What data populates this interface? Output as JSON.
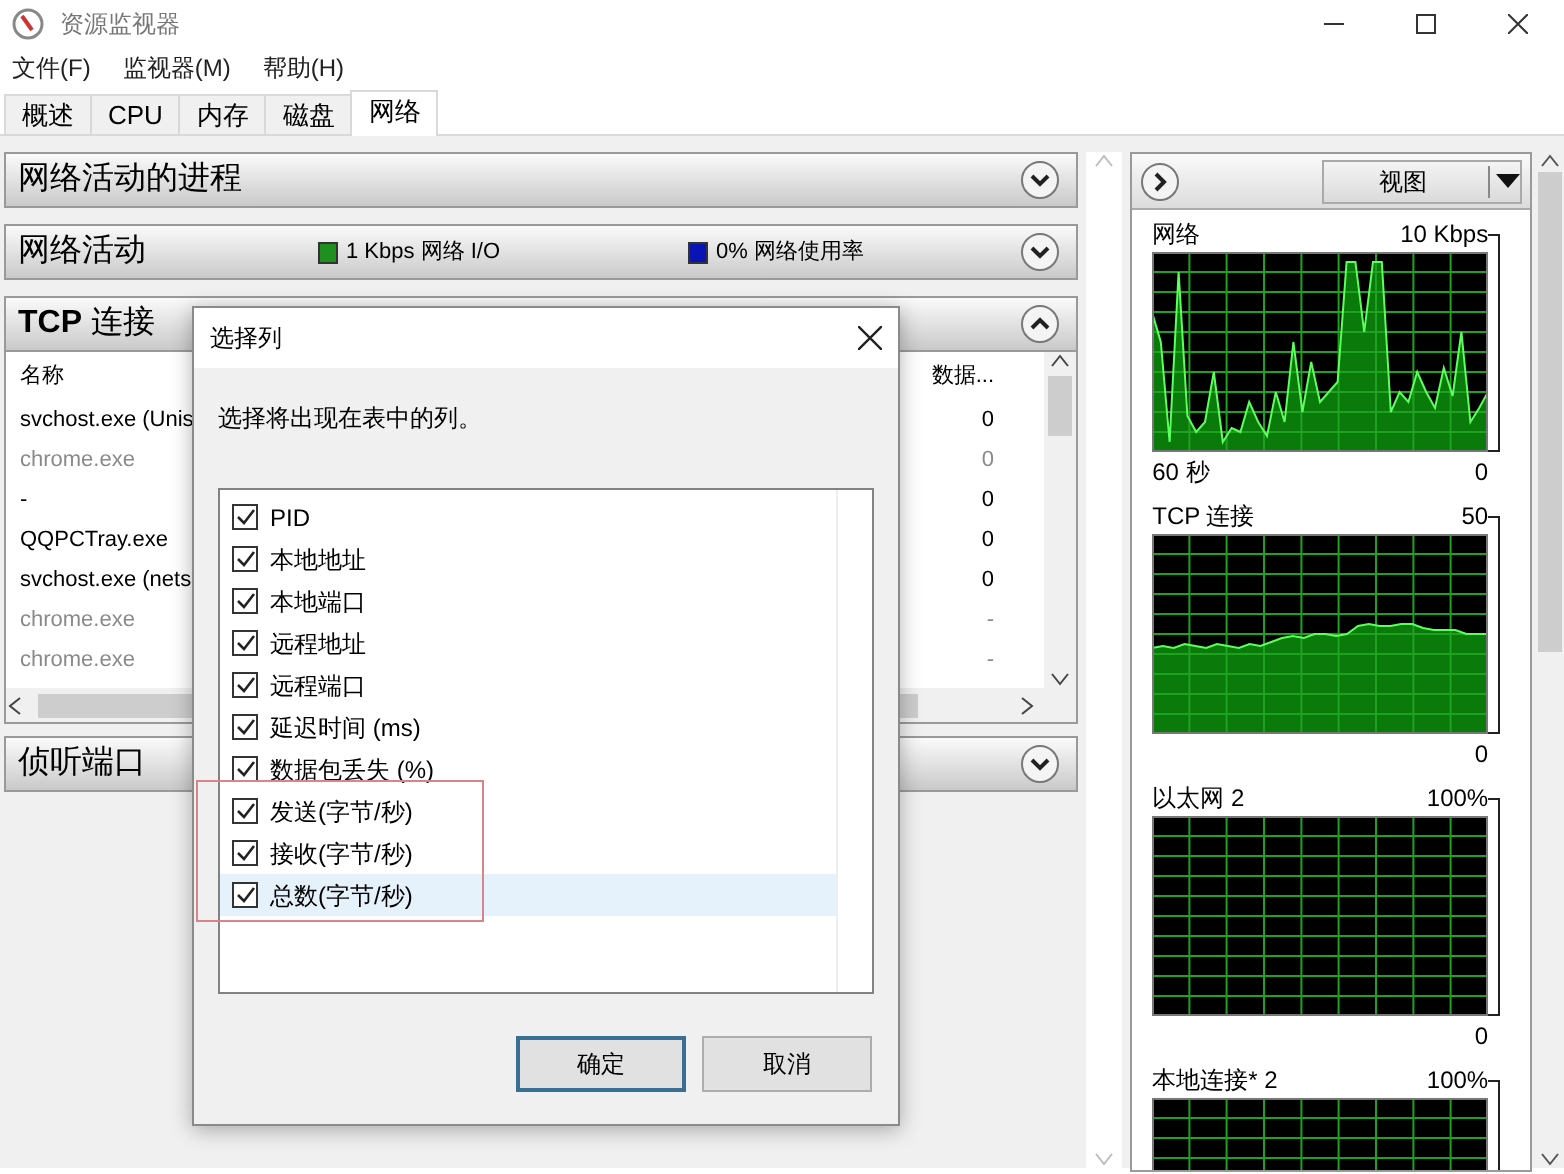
{
  "window": {
    "title": "资源监视器"
  },
  "menu": [
    {
      "label": "文件(F)"
    },
    {
      "label": "监视器(M)"
    },
    {
      "label": "帮助(H)"
    }
  ],
  "tabs": [
    {
      "label": "概述",
      "selected": false
    },
    {
      "label": "CPU",
      "selected": false
    },
    {
      "label": "内存",
      "selected": false
    },
    {
      "label": "磁盘",
      "selected": false
    },
    {
      "label": "网络",
      "selected": true
    }
  ],
  "sections": [
    {
      "kind": "plain",
      "title": "网络活动的进程",
      "expanded": false
    },
    {
      "kind": "activity",
      "title": "网络活动",
      "expanded": false,
      "legend": [
        {
          "text": "1 Kbps 网络 I/O",
          "color": "#1f8f1f"
        },
        {
          "text": "0% 网络使用率",
          "color": "#0a14b4"
        }
      ]
    },
    {
      "kind": "table",
      "title": "**TCP** 连接",
      "expanded": true,
      "table": {
        "columns": [
          "名称",
          "数据..."
        ],
        "rows": [
          [
            "svchost.exe (Unis",
            "0"
          ],
          [
            "chrome.exe",
            "0"
          ],
          [
            "-",
            "0"
          ],
          [
            "QQPCTray.exe",
            "0"
          ],
          [
            "svchost.exe (nets",
            "0"
          ],
          [
            "chrome.exe",
            "-"
          ],
          [
            "chrome.exe",
            "-"
          ]
        ],
        "dimmed": [
          false,
          true,
          false,
          false,
          false,
          true,
          true
        ]
      }
    },
    {
      "kind": "plain",
      "title": "侦听端口",
      "expanded": false
    }
  ],
  "graphs_panel": {
    "view_button": "视图",
    "graphs": [
      {
        "title": "网络",
        "max": "10 Kbps",
        "time": "60 秒",
        "min": "0"
      },
      {
        "title": "TCP 连接",
        "max": "50",
        "min": "0"
      },
      {
        "title": "以太网 2",
        "max": "100%",
        "min": "0"
      },
      {
        "title": "本地连接* 2",
        "max": "100%"
      }
    ]
  },
  "dialog": {
    "title": "选择列",
    "prompt": "选择将出现在表中的列。",
    "items": [
      {
        "label": "PID",
        "checked": true,
        "selected": false,
        "highlighted": false
      },
      {
        "label": "本地地址",
        "checked": true,
        "selected": false,
        "highlighted": false
      },
      {
        "label": "本地端口",
        "checked": true,
        "selected": false,
        "highlighted": false
      },
      {
        "label": "远程地址",
        "checked": true,
        "selected": false,
        "highlighted": false
      },
      {
        "label": "远程端口",
        "checked": true,
        "selected": false,
        "highlighted": false
      },
      {
        "label": "延迟时间 (ms)",
        "checked": true,
        "selected": false,
        "highlighted": false
      },
      {
        "label": "数据包丢失 (%)",
        "checked": true,
        "selected": false,
        "highlighted": false
      },
      {
        "label": "发送(字节/秒)",
        "checked": true,
        "selected": false,
        "highlighted": true
      },
      {
        "label": "接收(字节/秒)",
        "checked": true,
        "selected": false,
        "highlighted": true
      },
      {
        "label": "总数(字节/秒)",
        "checked": true,
        "selected": true,
        "highlighted": true
      }
    ],
    "buttons": [
      {
        "label": "确定",
        "default": true
      },
      {
        "label": "取消",
        "default": false
      }
    ]
  }
}
